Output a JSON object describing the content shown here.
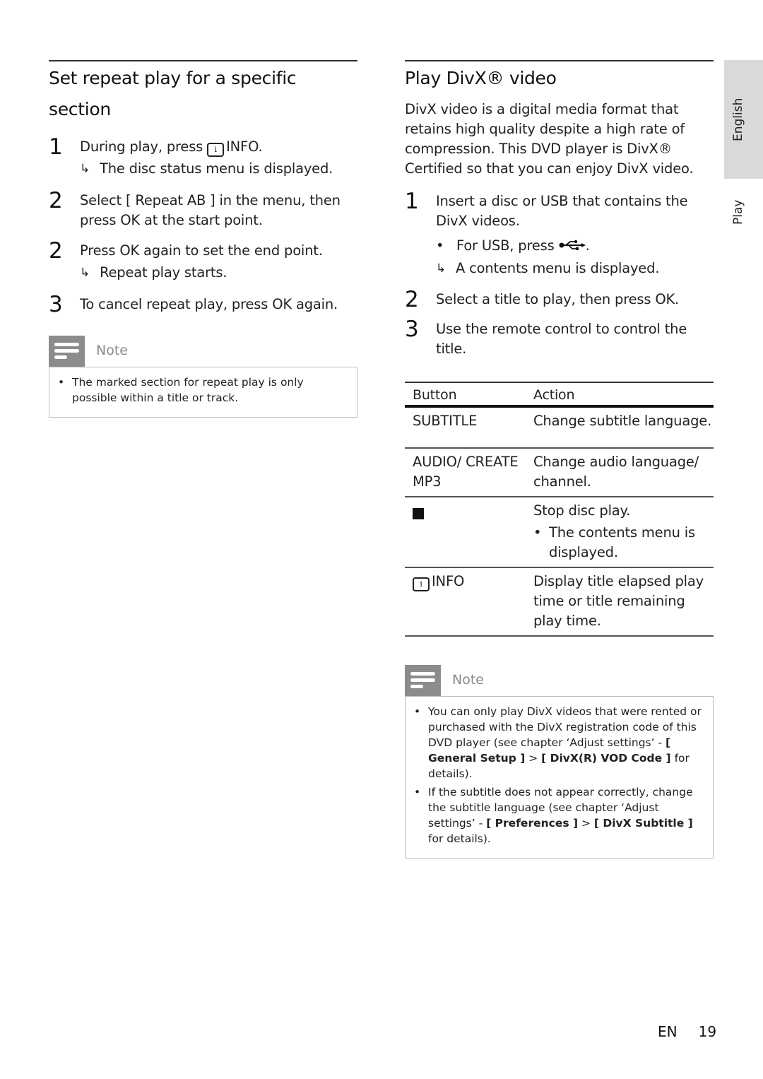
{
  "side_tabs": {
    "language": "English",
    "chapter": "Play"
  },
  "left": {
    "title": "Set repeat play for a specific section",
    "steps": [
      {
        "num": "1",
        "pre": "During play, press ",
        "icon": "info-icon",
        "icon_text": "i",
        "key": "INFO",
        "post": ".",
        "result": "The disc status menu is displayed."
      },
      {
        "num": "2",
        "pre": "Select ",
        "menu": "[ Repeat AB ]",
        "post": " in the menu, then press OK at the start point."
      },
      {
        "num": "2",
        "text": "Press OK again to set the end point.",
        "result": "Repeat play starts."
      },
      {
        "num": "3",
        "text": "To cancel repeat play, press OK again."
      }
    ],
    "note": {
      "title": "Note",
      "items": [
        "The marked section for repeat play is only possible within a title or track."
      ]
    }
  },
  "right": {
    "title": "Play DivX® video",
    "intro": "DivX video is a digital media format that retains high quality despite a high rate of compression. This DVD player is DivX® Certified so that you can enjoy DivX video.",
    "steps": [
      {
        "num": "1",
        "text": "Insert a disc or USB that contains the DivX videos.",
        "bullet_pre": "For USB, press ",
        "bullet_icon": "usb-icon",
        "bullet_post": ".",
        "result": "A contents menu is displayed."
      },
      {
        "num": "2",
        "text": "Select a title to play, then press OK."
      },
      {
        "num": "3",
        "text": "Use the remote control to control the title."
      }
    ],
    "table": {
      "headers": [
        "Button",
        "Action"
      ],
      "rows": [
        {
          "button": "SUBTITLE",
          "action": "Change subtitle language."
        },
        {
          "button": "AUDIO/ CREATE MP3",
          "action": "Change audio language/ channel."
        },
        {
          "button_icon": "stop-icon",
          "action": "Stop disc play.",
          "sub_bullet": "The contents menu is displayed."
        },
        {
          "button_icon": "info-icon",
          "button_icon_text": "i",
          "button": "INFO",
          "action": "Display title elapsed play time or title remaining play time."
        }
      ]
    },
    "note": {
      "title": "Note",
      "items": [
        {
          "pre": "You can only play DivX videos that were rented or purchased with the DivX registration code of this DVD player (see chapter ‘Adjust settings’ - ",
          "b1": "[ General Setup ]",
          "mid": " > ",
          "b2": "[ DivX(R) VOD Code ]",
          "post": " for details)."
        },
        {
          "pre": "If the subtitle does not appear correctly, change the subtitle language (see chapter ‘Adjust settings’ - ",
          "b1": "[ Preferences ]",
          "mid": " > ",
          "b2": "[ DivX Subtitle ]",
          "post": " for details)."
        }
      ]
    }
  },
  "footer": {
    "lang": "EN",
    "page": "19"
  },
  "symbols": {
    "arrow": "↳",
    "bullet": "•"
  }
}
